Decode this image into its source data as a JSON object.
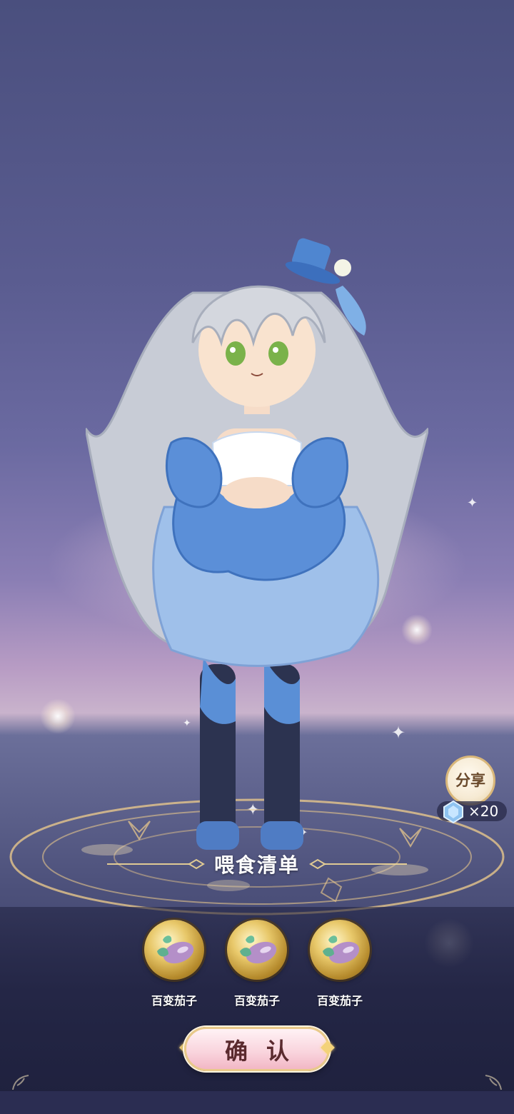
{
  "feed_list": {
    "title": "喂食清单",
    "items": [
      {
        "label": "百变茄子",
        "icon": "eggplant-icon"
      },
      {
        "label": "百变茄子",
        "icon": "eggplant-icon"
      },
      {
        "label": "百变茄子",
        "icon": "eggplant-icon"
      }
    ]
  },
  "share": {
    "label": "分享",
    "reward_icon": "crystal-gem-icon",
    "reward_count": "×20"
  },
  "confirm": {
    "label": "确认"
  },
  "colors": {
    "confirm_bg": "#f9d3dc",
    "confirm_text": "#5a2a2e",
    "orb_gold": "#e8c86a",
    "sky_top": "#4a4f7e",
    "panel_dark": "#1e203e"
  }
}
